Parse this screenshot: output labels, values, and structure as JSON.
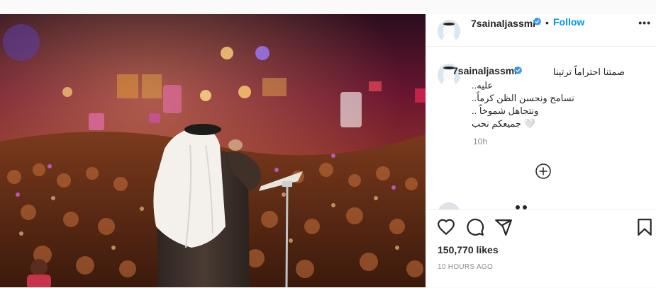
{
  "post": {
    "username": "7sainaljassmi",
    "follow_label": "Follow",
    "separator": "•",
    "more_label": "•••",
    "caption": {
      "first_line": "صمتنا احتراماً ترتينا",
      "lines": [
        "..عليه",
        "..نسامح ونحسن الظن كرماً",
        ".. ونتجاهل شموخاً",
        "جميعكم نحب 🤍"
      ]
    },
    "relative_time": "10h",
    "likes": "150,770 likes",
    "time_ago": "10 HOURS AGO"
  },
  "icons": {
    "verified": "verified-badge-icon",
    "load_more": "plus-circle-icon",
    "like": "heart-icon",
    "comment": "comment-icon",
    "share": "paper-plane-icon",
    "save": "bookmark-icon",
    "more": "more-options-icon"
  },
  "colors": {
    "accent": "#0095f6",
    "text": "#262626",
    "muted": "#8e8e8e",
    "border": "#efefef"
  }
}
